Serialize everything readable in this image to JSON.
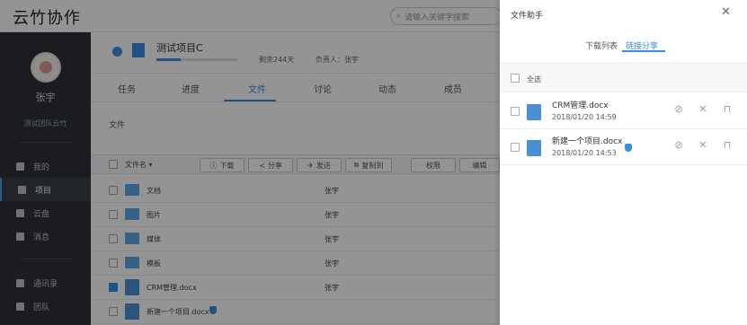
{
  "app": {
    "title": "云竹协作",
    "search_placeholder": "请输入关键字搜索"
  },
  "user": {
    "name": "张宇",
    "team": "测试团队云竹"
  },
  "nav": [
    {
      "label": "我的"
    },
    {
      "label": "项目"
    },
    {
      "label": "云盘"
    },
    {
      "label": "消息"
    },
    {
      "label": "通讯录"
    },
    {
      "label": "团队"
    }
  ],
  "project": {
    "name": "测试项目C",
    "remaining": "剩余244天",
    "owner": "负责人：张宇",
    "progress": 0.3
  },
  "tabs": [
    {
      "label": "任务"
    },
    {
      "label": "进度"
    },
    {
      "label": "文件"
    },
    {
      "label": "讨论"
    },
    {
      "label": "动态"
    },
    {
      "label": "成员"
    }
  ],
  "breadcrumb": "文件",
  "toolbar": {
    "name_header": "文件名",
    "download": "下载",
    "share": "分享",
    "send": "发送",
    "copy": "复制到",
    "permission": "权限",
    "edit": "编辑"
  },
  "files": [
    {
      "name": "文档",
      "owner": "张宇",
      "type": "folder",
      "checked": false
    },
    {
      "name": "图片",
      "owner": "张宇",
      "type": "folder",
      "checked": false
    },
    {
      "name": "媒体",
      "owner": "张宇",
      "type": "folder",
      "checked": false
    },
    {
      "name": "模板",
      "owner": "张宇",
      "type": "folder",
      "checked": false
    },
    {
      "name": "CRM管理.docx",
      "owner": "张宇",
      "type": "doc",
      "checked": true
    },
    {
      "name": "新建一个项目.docx",
      "owner": "",
      "type": "doc",
      "checked": false
    }
  ],
  "panel": {
    "title": "文件助手",
    "tabs": [
      {
        "label": "下载列表"
      },
      {
        "label": "链接分享"
      }
    ],
    "select_all": "全选",
    "items": [
      {
        "name": "CRM管理.docx",
        "date": "2018/01/20 14:59"
      },
      {
        "name": "新建一个项目.docx",
        "date": "2018/01/20 14:53"
      }
    ]
  },
  "colors": {
    "accent": "#3a8ee6",
    "sidebar": "#2e3137"
  }
}
